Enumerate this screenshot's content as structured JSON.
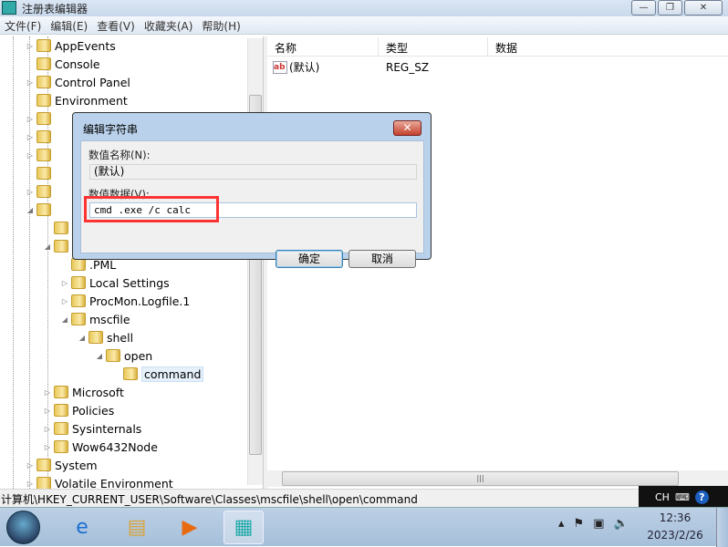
{
  "window": {
    "title": "注册表编辑器",
    "min": "—",
    "max": "❐",
    "close": "✕"
  },
  "menu": [
    "文件(F)",
    "编辑(E)",
    "查看(V)",
    "收藏夹(A)",
    "帮助(H)"
  ],
  "tree": [
    {
      "label": "AppEvents",
      "level": 1,
      "arrow": "▷"
    },
    {
      "label": "Console",
      "level": 1,
      "arrow": ""
    },
    {
      "label": "Control Panel",
      "level": 1,
      "arrow": "▷"
    },
    {
      "label": "Environment",
      "level": 1,
      "arrow": ""
    },
    {
      "label": "",
      "level": 1,
      "arrow": "▷"
    },
    {
      "label": "",
      "level": 1,
      "arrow": "▷"
    },
    {
      "label": "",
      "level": 1,
      "arrow": "▷"
    },
    {
      "label": "",
      "level": 1,
      "arrow": ""
    },
    {
      "label": "",
      "level": 1,
      "arrow": "▷"
    },
    {
      "label": "",
      "level": 1,
      "arrow": "◢"
    },
    {
      "label": "",
      "level": 2,
      "arrow": ""
    },
    {
      "label": "",
      "level": 2,
      "arrow": "◢"
    },
    {
      "label": ".PML",
      "level": 3,
      "arrow": ""
    },
    {
      "label": "Local Settings",
      "level": 3,
      "arrow": "▷"
    },
    {
      "label": "ProcMon.Logfile.1",
      "level": 3,
      "arrow": "▷"
    },
    {
      "label": "mscfile",
      "level": 3,
      "arrow": "◢"
    },
    {
      "label": "shell",
      "level": 4,
      "arrow": "◢"
    },
    {
      "label": "open",
      "level": 5,
      "arrow": "◢"
    },
    {
      "label": "command",
      "level": 6,
      "arrow": "",
      "selected": true
    },
    {
      "label": "Microsoft",
      "level": 2,
      "arrow": "▷"
    },
    {
      "label": "Policies",
      "level": 2,
      "arrow": "▷"
    },
    {
      "label": "Sysinternals",
      "level": 2,
      "arrow": "▷"
    },
    {
      "label": "Wow6432Node",
      "level": 2,
      "arrow": "▷"
    },
    {
      "label": "System",
      "level": 1,
      "arrow": "▷"
    },
    {
      "label": "Volatile Environment",
      "level": 1,
      "arrow": "▷"
    }
  ],
  "list": {
    "columns": [
      "名称",
      "类型",
      "数据"
    ],
    "rows": [
      {
        "name": "(默认)",
        "type": "REG_SZ",
        "data": ""
      }
    ]
  },
  "status": "计算机\\HKEY_CURRENT_USER\\Software\\Classes\\mscfile\\shell\\open\\command",
  "langbar": {
    "lang": "CH",
    "help": "?"
  },
  "dialog": {
    "title": "编辑字符串",
    "name_label": "数值名称(N):",
    "name_value": "(默认)",
    "data_label": "数值数据(V):",
    "data_value": "cmd .exe /c calc",
    "ok": "确定",
    "cancel": "取消",
    "highlight_color": "#ff3333"
  },
  "clock": {
    "time": "12:36",
    "date": "2023/2/26"
  }
}
